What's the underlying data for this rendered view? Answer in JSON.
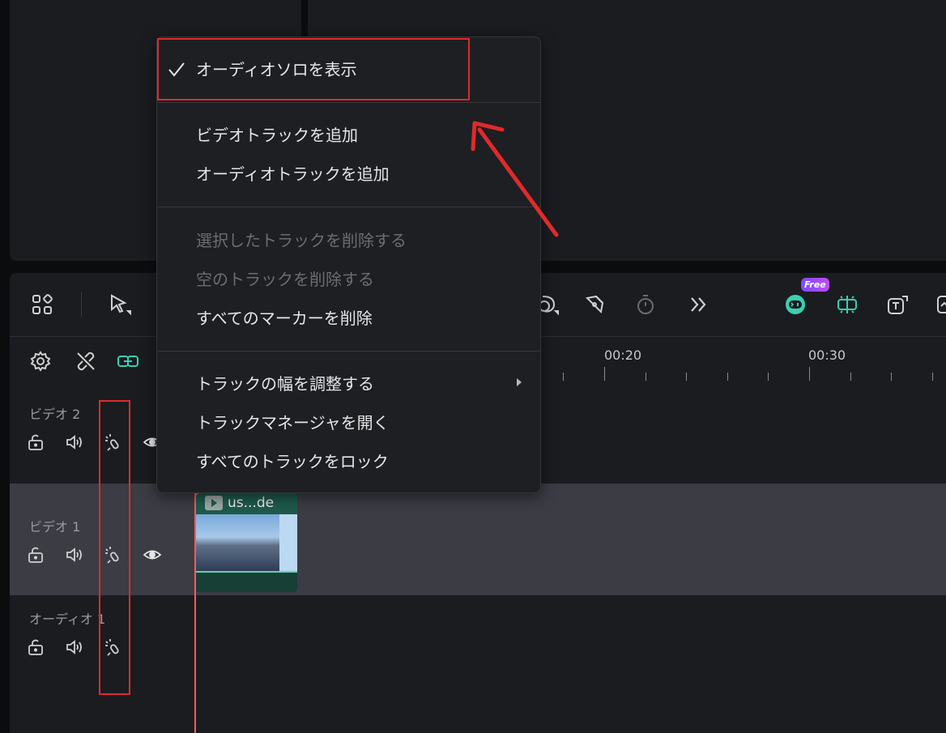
{
  "menu": {
    "items": [
      {
        "label": "オーディオソロを表示",
        "checked": true,
        "enabled": true
      },
      {
        "label": "ビデオトラックを追加",
        "enabled": true
      },
      {
        "label": "オーディオトラックを追加",
        "enabled": true
      },
      {
        "label": "選択したトラックを削除する",
        "enabled": false
      },
      {
        "label": "空のトラックを削除する",
        "enabled": false
      },
      {
        "label": "すべてのマーカーを削除",
        "enabled": true
      },
      {
        "label": "トラックの幅を調整する",
        "enabled": true,
        "has_submenu": true
      },
      {
        "label": "トラックマネージャを開く",
        "enabled": true
      },
      {
        "label": "すべてのトラックをロック",
        "enabled": true
      }
    ]
  },
  "ruler": {
    "labels": [
      "00:20",
      "00:30"
    ]
  },
  "tracks": [
    {
      "name": "ビデオ 2"
    },
    {
      "name": "ビデオ 1"
    },
    {
      "name": "オーディオ 1"
    }
  ],
  "clip": {
    "title": "us...de"
  },
  "toolbar": {
    "free_badge": "Free"
  },
  "colors": {
    "highlight": "#e02a2a",
    "accent": "#5fd3b3",
    "playhead": "#ff5a5a"
  }
}
